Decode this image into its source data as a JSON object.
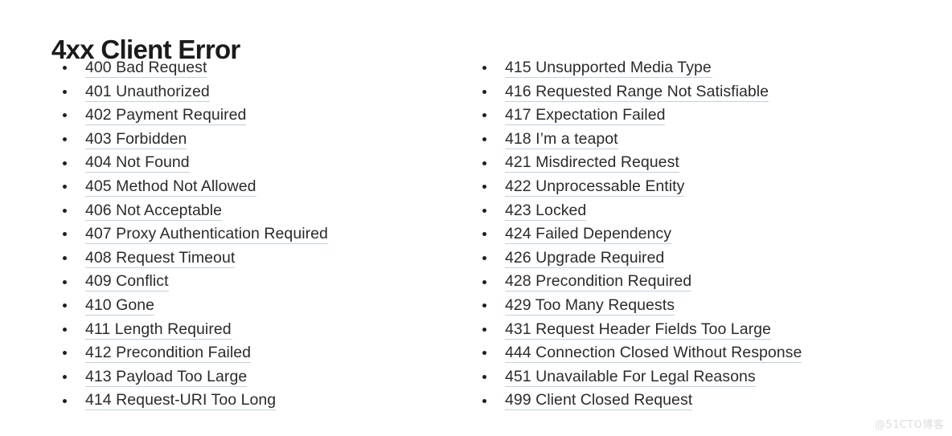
{
  "page": {
    "title": "4xx Client Error",
    "background_color": "#ffffff",
    "title_color": "#1b1b1b",
    "link_color": "#2b2b2b",
    "link_underline_color": "#c3cfe2",
    "bullet_color": "#202020"
  },
  "watermark": {
    "text": "@51CTO博客",
    "color": "#dcdcdc"
  },
  "columns": [
    {
      "name": "left-column",
      "items": [
        {
          "code": "400",
          "label": "400 Bad Request"
        },
        {
          "code": "401",
          "label": "401 Unauthorized"
        },
        {
          "code": "402",
          "label": "402 Payment Required"
        },
        {
          "code": "403",
          "label": "403 Forbidden"
        },
        {
          "code": "404",
          "label": "404 Not Found"
        },
        {
          "code": "405",
          "label": "405 Method Not Allowed"
        },
        {
          "code": "406",
          "label": "406 Not Acceptable"
        },
        {
          "code": "407",
          "label": "407 Proxy Authentication Required"
        },
        {
          "code": "408",
          "label": "408 Request Timeout"
        },
        {
          "code": "409",
          "label": "409 Conflict"
        },
        {
          "code": "410",
          "label": "410 Gone"
        },
        {
          "code": "411",
          "label": "411 Length Required"
        },
        {
          "code": "412",
          "label": "412 Precondition Failed"
        },
        {
          "code": "413",
          "label": "413 Payload Too Large"
        },
        {
          "code": "414",
          "label": "414 Request-URI Too Long"
        }
      ]
    },
    {
      "name": "right-column",
      "items": [
        {
          "code": "415",
          "label": "415 Unsupported Media Type"
        },
        {
          "code": "416",
          "label": "416 Requested Range Not Satisfiable"
        },
        {
          "code": "417",
          "label": "417 Expectation Failed"
        },
        {
          "code": "418",
          "label": "418 I’m a teapot"
        },
        {
          "code": "421",
          "label": "421 Misdirected Request"
        },
        {
          "code": "422",
          "label": "422 Unprocessable Entity"
        },
        {
          "code": "423",
          "label": "423 Locked"
        },
        {
          "code": "424",
          "label": "424 Failed Dependency"
        },
        {
          "code": "426",
          "label": "426 Upgrade Required"
        },
        {
          "code": "428",
          "label": "428 Precondition Required"
        },
        {
          "code": "429",
          "label": "429 Too Many Requests"
        },
        {
          "code": "431",
          "label": "431 Request Header Fields Too Large"
        },
        {
          "code": "444",
          "label": "444 Connection Closed Without Response"
        },
        {
          "code": "451",
          "label": "451 Unavailable For Legal Reasons"
        },
        {
          "code": "499",
          "label": "499 Client Closed Request"
        }
      ]
    }
  ]
}
